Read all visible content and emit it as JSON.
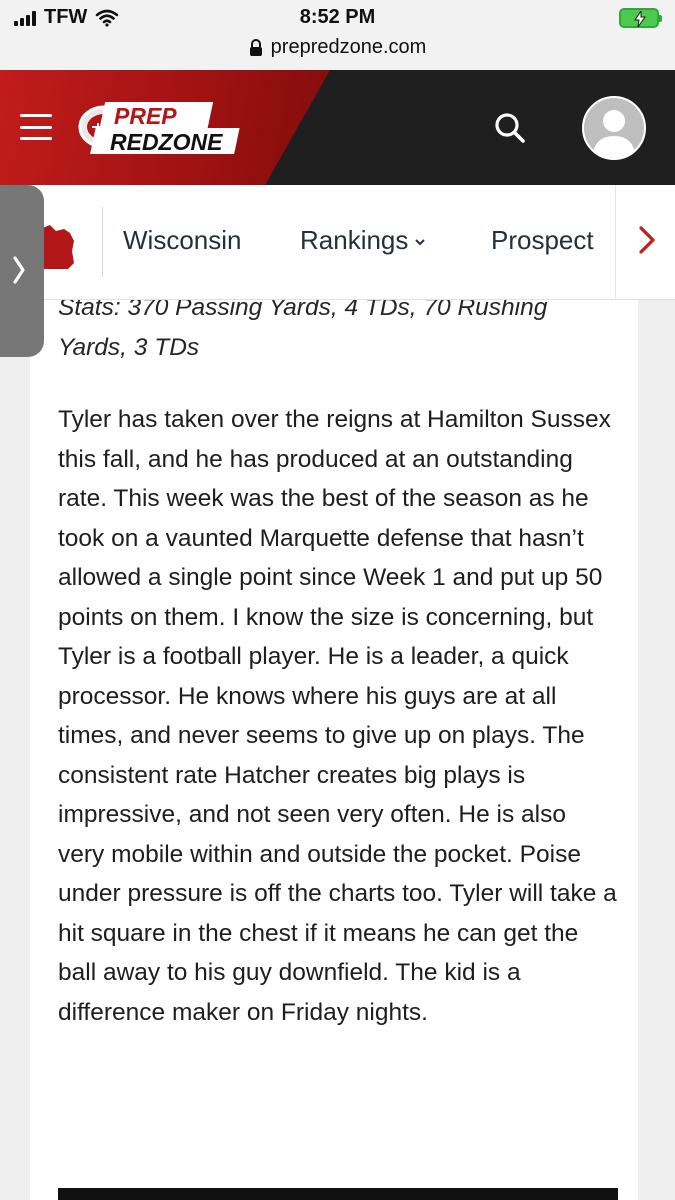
{
  "status_bar": {
    "carrier": "TFW",
    "time": "8:52 PM",
    "url": "prepredzone.com",
    "icons": [
      "signal-icon",
      "wifi-icon",
      "lock-icon",
      "battery-charging-icon"
    ]
  },
  "header": {
    "logo_line1": "PREP",
    "logo_line2": "REDZONE",
    "icons": [
      "menu-icon",
      "search-icon",
      "user-avatar-icon"
    ],
    "colors": {
      "background": "#1f1f1f",
      "accent": "#c21c1c"
    }
  },
  "nav": {
    "items": [
      {
        "label": "Wisconsin"
      },
      {
        "label": "Rankings"
      },
      {
        "label": "Prospect"
      }
    ],
    "icons": [
      "wisconsin-map-icon",
      "chevron-down-icon",
      "chevron-right-icon"
    ]
  },
  "article": {
    "stats": "Stats: 370 Passing Yards, 4 TDs, 70 Rushing Yards, 3 TDs",
    "body": "Tyler has taken over the reigns at Hamilton Sussex this fall, and he has produced at an outstanding rate. This week was the best of the season as he took on a vaunted Marquette defense that hasn’t allowed a single point since Week 1 and put up 50 points on them. I know the size is concerning, but Tyler is a football player. He is a leader, a quick processor. He knows where his guys are at all times, and never seems to give up on plays. The consistent rate Hatcher creates big plays is impressive, and not seen very often. He is also very mobile within and outside the pocket. Poise under pressure is off the charts too. Tyler will take a hit square in the chest if it means he can get the ball away to his guy downfield. The kid is a difference maker on Friday nights."
  }
}
